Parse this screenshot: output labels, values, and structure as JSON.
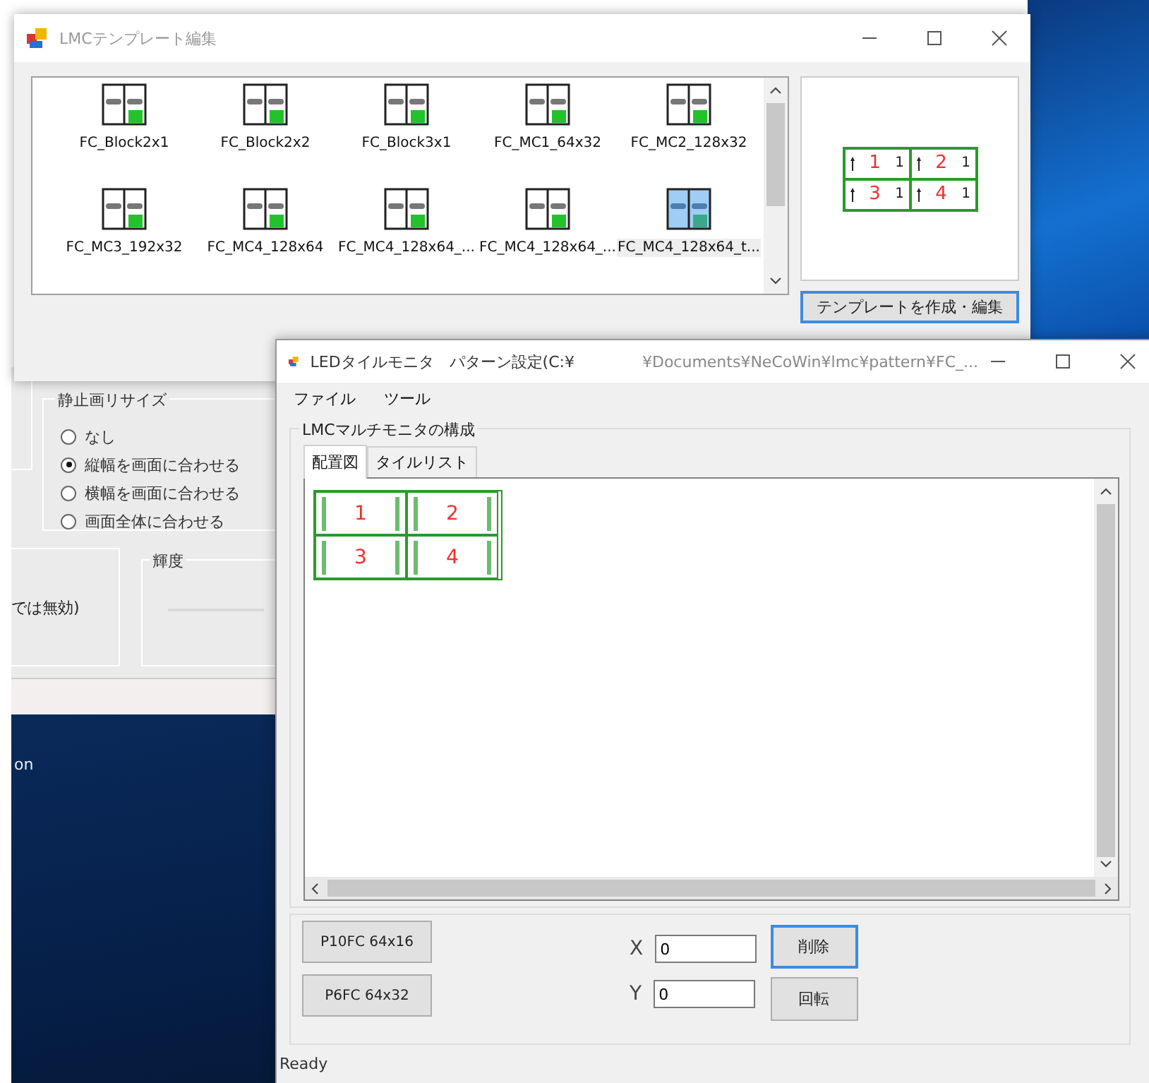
{
  "desktop": {
    "text": "on"
  },
  "back_window": {
    "resize_group": {
      "title": "静止画リサイズ",
      "options": [
        {
          "label": "なし",
          "selected": false
        },
        {
          "label": "縦幅を画面に合わせる",
          "selected": true
        },
        {
          "label": "横幅を画面に合わせる",
          "selected": false
        },
        {
          "label": "画面全体に合わせる",
          "selected": false
        }
      ]
    },
    "brightness_group": {
      "title": "輝度"
    },
    "note": "では無効)"
  },
  "template_window": {
    "title": "LMCテンプレート編集",
    "items": [
      {
        "label": "FC_Block2x1",
        "selected": false
      },
      {
        "label": "FC_Block2x2",
        "selected": false
      },
      {
        "label": "FC_Block3x1",
        "selected": false
      },
      {
        "label": "FC_MC1_64x32",
        "selected": false
      },
      {
        "label": "FC_MC2_128x32",
        "selected": false
      },
      {
        "label": "FC_MC3_192x32",
        "selected": false
      },
      {
        "label": "FC_MC4_128x64",
        "selected": false
      },
      {
        "label": "FC_MC4_128x64_...",
        "selected": false
      },
      {
        "label": "FC_MC4_128x64_...",
        "selected": false
      },
      {
        "label": "FC_MC4_128x64_t...",
        "selected": true
      }
    ],
    "preview_tiles": [
      {
        "number": "1",
        "mark": "1"
      },
      {
        "number": "2",
        "mark": "1"
      },
      {
        "number": "3",
        "mark": "1"
      },
      {
        "number": "4",
        "mark": "1"
      }
    ],
    "button": "テンプレートを作成・編集"
  },
  "monitor_window": {
    "title": "LEDタイルモニタ　パターン設定(C:¥",
    "title_path": "¥Documents¥NeCoWin¥lmc¥pattern¥FC_...",
    "menu": [
      "ファイル",
      "ツール"
    ],
    "group_title": "LMCマルチモニタの構成",
    "tabs": [
      {
        "label": "配置図",
        "selected": true
      },
      {
        "label": "タイルリスト",
        "selected": false
      }
    ],
    "tiles": [
      "1",
      "2",
      "3",
      "4"
    ],
    "tile_buttons": [
      "P10FC 64x16",
      "P6FC 64x32"
    ],
    "fields": [
      {
        "label": "X",
        "value": "0"
      },
      {
        "label": "Y",
        "value": "0"
      }
    ],
    "actions": [
      {
        "label": "削除",
        "focused": true
      },
      {
        "label": "回転",
        "focused": false
      }
    ],
    "status": "Ready"
  }
}
